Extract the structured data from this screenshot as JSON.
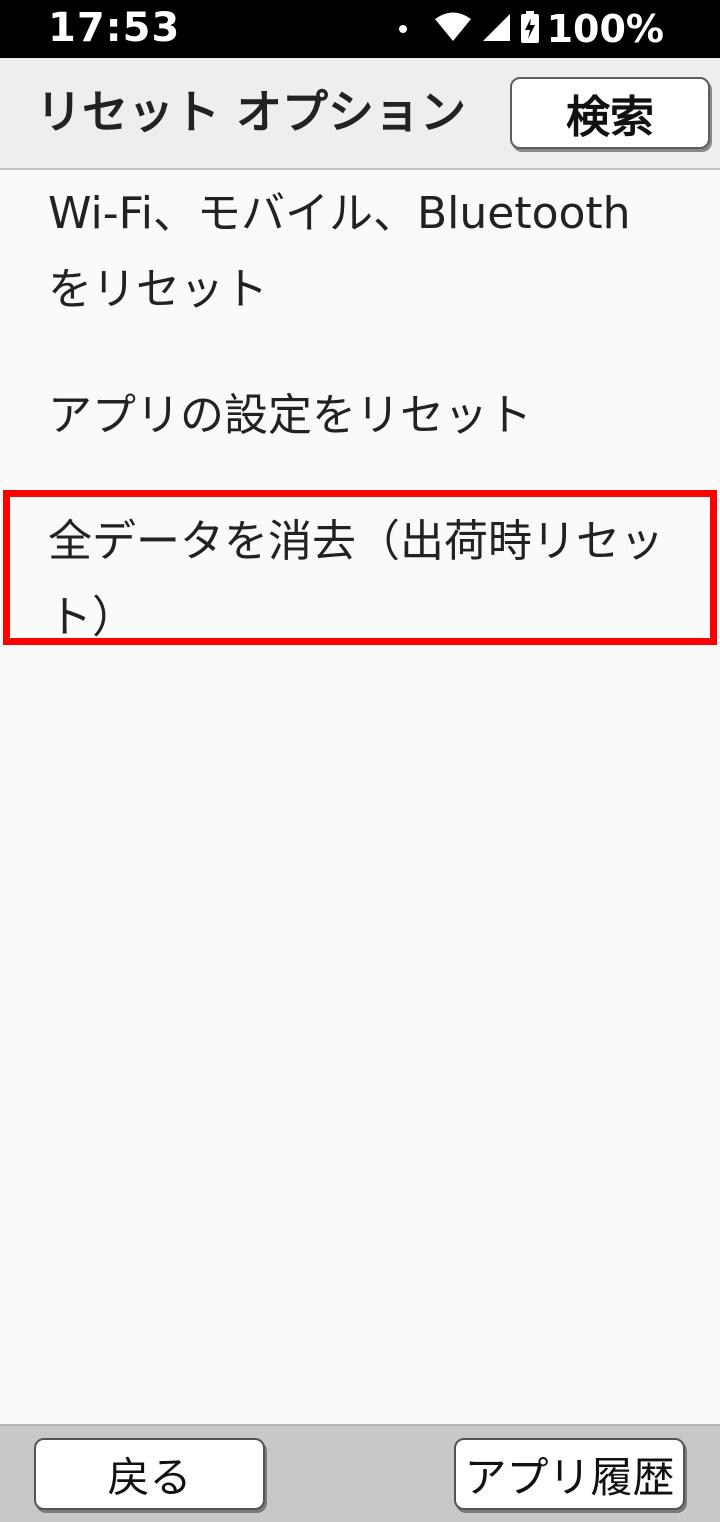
{
  "status_bar": {
    "time": "17:53",
    "battery": "100%",
    "icons": [
      "notification-dot-icon",
      "wifi-icon",
      "cell-signal-icon",
      "battery-charging-icon"
    ]
  },
  "header": {
    "title": "リセット オプション",
    "search_label": "検索"
  },
  "list": {
    "items": [
      {
        "label": "Wi-Fi、モバイル、Bluetooth をリセット"
      },
      {
        "label": "アプリの設定をリセット"
      },
      {
        "label": "全データを消去（出荷時リセット）"
      }
    ]
  },
  "highlight": {
    "color": "#ff0000"
  },
  "bottom_bar": {
    "back_label": "戻る",
    "history_label": "アプリ履歴"
  }
}
